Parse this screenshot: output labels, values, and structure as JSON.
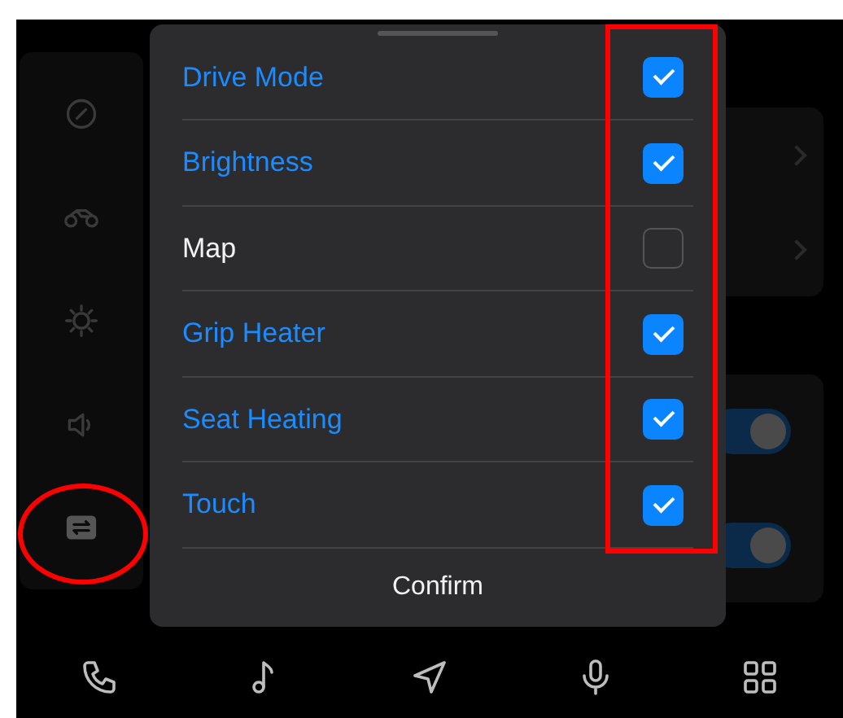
{
  "sidebar": {
    "items": [
      {
        "kind": "gauge",
        "selected": false
      },
      {
        "kind": "motorcycle",
        "selected": false
      },
      {
        "kind": "sun",
        "selected": false
      },
      {
        "kind": "speaker",
        "selected": false
      },
      {
        "kind": "switch",
        "selected": true
      }
    ]
  },
  "background_cards": [
    {
      "kind": "links",
      "rows": [
        {
          "kind": "chevron"
        },
        {
          "kind": "chevron"
        }
      ]
    },
    {
      "kind": "toggles",
      "toggles": [
        {
          "on": true
        },
        {
          "on": true
        }
      ]
    }
  ],
  "dialog": {
    "items": [
      {
        "label": "Drive Mode",
        "checked": true
      },
      {
        "label": "Brightness",
        "checked": true
      },
      {
        "label": "Map",
        "checked": false
      },
      {
        "label": "Grip Heater",
        "checked": true
      },
      {
        "label": "Seat Heating",
        "checked": true
      },
      {
        "label": "Touch",
        "checked": true
      }
    ],
    "confirm": "Confirm"
  },
  "bottom_nav": [
    {
      "kind": "phone"
    },
    {
      "kind": "music"
    },
    {
      "kind": "navigation"
    },
    {
      "kind": "microphone"
    },
    {
      "kind": "grid"
    }
  ],
  "annotations": [
    {
      "kind": "rectangle"
    },
    {
      "kind": "ellipse"
    }
  ]
}
